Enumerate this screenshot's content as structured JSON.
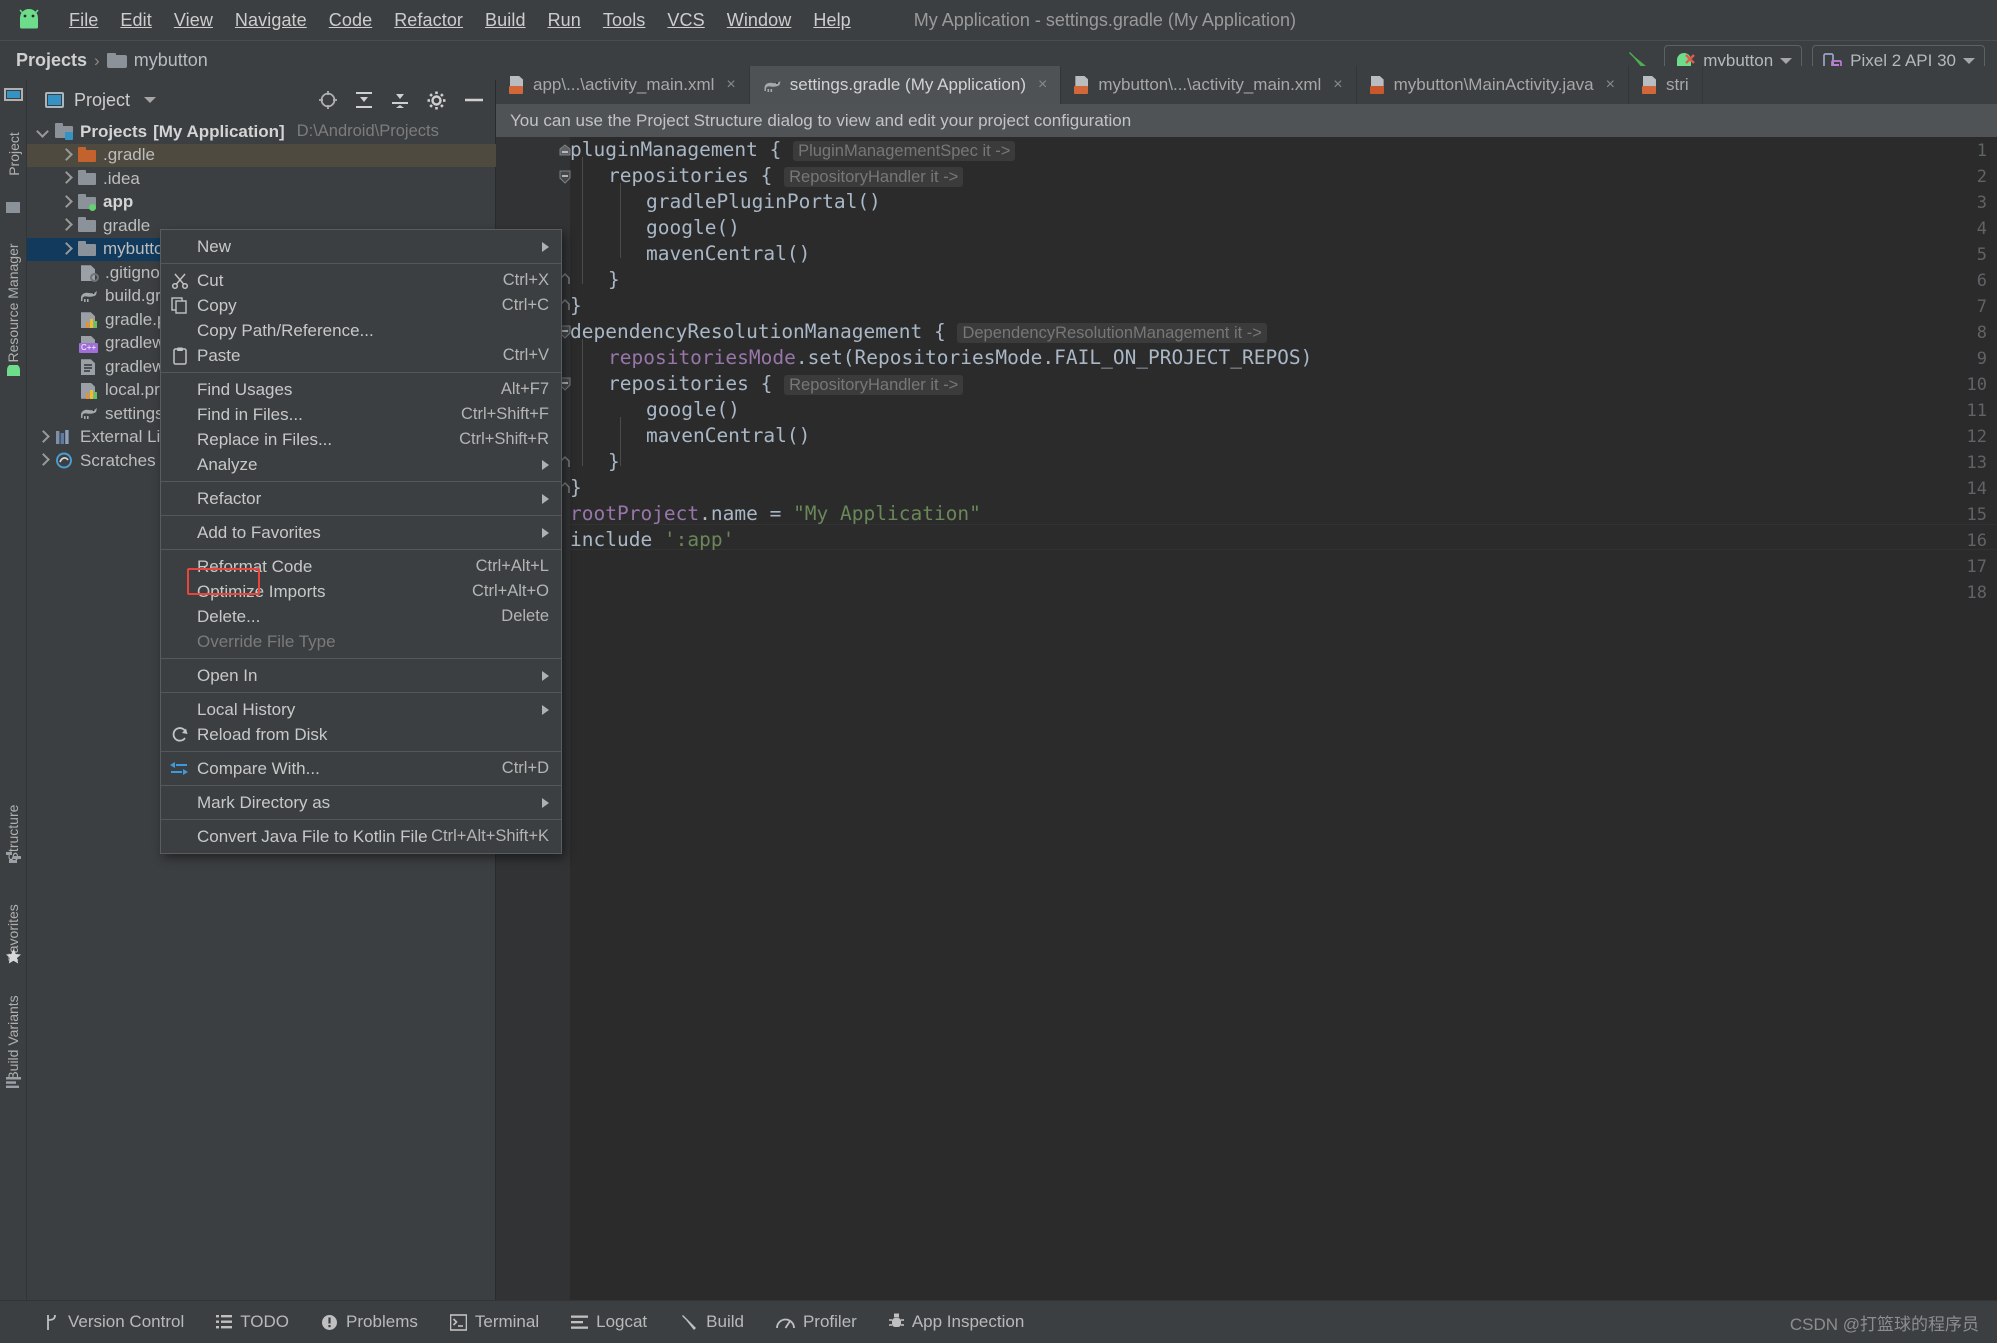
{
  "window": {
    "title": "My Application - settings.gradle (My Application)",
    "logo_icon": "android-logo-icon"
  },
  "menubar": {
    "items": [
      {
        "label": "File",
        "mnemonic": "F"
      },
      {
        "label": "Edit",
        "mnemonic": "E"
      },
      {
        "label": "View",
        "mnemonic": "V"
      },
      {
        "label": "Navigate",
        "mnemonic": "N"
      },
      {
        "label": "Code",
        "mnemonic": "C"
      },
      {
        "label": "Refactor",
        "mnemonic": "R"
      },
      {
        "label": "Build",
        "mnemonic": "B"
      },
      {
        "label": "Run",
        "mnemonic": "u"
      },
      {
        "label": "Tools",
        "mnemonic": "T"
      },
      {
        "label": "VCS",
        "mnemonic": "S"
      },
      {
        "label": "Window",
        "mnemonic": "W"
      },
      {
        "label": "Help",
        "mnemonic": "H"
      }
    ]
  },
  "navbar": {
    "root": "Projects",
    "separator": "›",
    "current": "mybutton",
    "hammer_icon": "hammer-icon",
    "run_config": "mybutton",
    "device": "Pixel 2 API 30"
  },
  "left_strip": {
    "top_labels": [
      "Project",
      "Resource Manager"
    ],
    "bottom_labels": [
      "Structure",
      "Favorites",
      "Build Variants"
    ]
  },
  "project_panel": {
    "title": "Project",
    "actions": [
      "locate-icon",
      "collapse-all-icon",
      "expand-icon",
      "settings-gear-icon",
      "minimize-icon"
    ],
    "tree": [
      {
        "label": "Projects",
        "suffix": "[My Application]",
        "path": "D:\\Android\\Projects",
        "icon": "project-folder-icon",
        "indent": 0,
        "arrow": "down",
        "bold": true,
        "state": "normal"
      },
      {
        "label": ".gradle",
        "icon": "folder-orange-icon",
        "indent": 1,
        "arrow": "right",
        "state": "selected-inactive"
      },
      {
        "label": ".idea",
        "icon": "folder-icon",
        "indent": 1,
        "arrow": "right",
        "state": "normal"
      },
      {
        "label": "app",
        "icon": "folder-module-icon",
        "indent": 1,
        "arrow": "right",
        "bold": true,
        "state": "normal"
      },
      {
        "label": "gradle",
        "icon": "folder-icon",
        "indent": 1,
        "arrow": "right",
        "state": "normal"
      },
      {
        "label": "mybutton",
        "icon": "folder-icon",
        "indent": 1,
        "arrow": "right",
        "state": "selected-active"
      },
      {
        "label": ".gitignore",
        "icon": "gitignore-file-icon",
        "indent": 2,
        "arrow": "none",
        "state": "normal"
      },
      {
        "label": "build.gra",
        "icon": "gradle-file-icon",
        "indent": 2,
        "arrow": "none",
        "state": "normal"
      },
      {
        "label": "gradle.pro",
        "icon": "properties-file-icon",
        "indent": 2,
        "arrow": "none",
        "state": "normal"
      },
      {
        "label": "gradlew",
        "icon": "cpp-file-icon",
        "indent": 2,
        "arrow": "none",
        "state": "normal"
      },
      {
        "label": "gradlew.b",
        "icon": "text-file-icon",
        "indent": 2,
        "arrow": "none",
        "state": "normal"
      },
      {
        "label": "local.prop",
        "icon": "properties-file-icon",
        "indent": 2,
        "arrow": "none",
        "state": "normal"
      },
      {
        "label": "settings.g",
        "icon": "gradle-file-icon",
        "indent": 2,
        "arrow": "none",
        "state": "normal"
      },
      {
        "label": "External Libr",
        "icon": "library-icon",
        "indent": 0,
        "arrow": "right",
        "state": "normal"
      },
      {
        "label": "Scratches an",
        "icon": "scratches-icon",
        "indent": 0,
        "arrow": "right",
        "state": "normal"
      }
    ]
  },
  "editor_tabs": [
    {
      "label": "app\\...\\activity_main.xml",
      "icon": "xml-file-icon",
      "active": false,
      "close": "×"
    },
    {
      "label": "settings.gradle (My Application)",
      "icon": "gradle-file-icon",
      "active": true,
      "close": "×"
    },
    {
      "label": "mybutton\\...\\activity_main.xml",
      "icon": "xml-file-icon",
      "active": false,
      "close": "×"
    },
    {
      "label": "mybutton\\MainActivity.java",
      "icon": "java-file-icon",
      "active": false,
      "close": "×"
    },
    {
      "label": "stri",
      "icon": "xml-file-icon",
      "active": false,
      "close": ""
    }
  ],
  "hint_bar": {
    "text": "You can use the Project Structure dialog to view and edit your project configuration"
  },
  "editor": {
    "filename": "settings.gradle",
    "lines": [
      {
        "no": "1",
        "indent": 0,
        "fold": "minus",
        "tokens": [
          {
            "t": "pluginManagement {",
            "c": "plain"
          },
          {
            "t": "PluginManagementSpec it ->",
            "c": "ghost"
          }
        ]
      },
      {
        "no": "2",
        "indent": 1,
        "fold": "minus",
        "tokens": [
          {
            "t": "repositories {",
            "c": "plain"
          },
          {
            "t": "RepositoryHandler it ->",
            "c": "ghost"
          }
        ]
      },
      {
        "no": "3",
        "indent": 2,
        "fold": "none",
        "tokens": [
          {
            "t": "gradlePluginPortal()",
            "c": "plain"
          }
        ]
      },
      {
        "no": "4",
        "indent": 2,
        "fold": "none",
        "tokens": [
          {
            "t": "google()",
            "c": "plain"
          }
        ]
      },
      {
        "no": "5",
        "indent": 2,
        "fold": "none",
        "tokens": [
          {
            "t": "mavenCentral()",
            "c": "plain"
          }
        ]
      },
      {
        "no": "6",
        "indent": 1,
        "fold": "end",
        "tokens": [
          {
            "t": "}",
            "c": "plain"
          }
        ]
      },
      {
        "no": "7",
        "indent": 0,
        "fold": "end",
        "tokens": [
          {
            "t": "}",
            "c": "plain"
          }
        ]
      },
      {
        "no": "8",
        "indent": 0,
        "fold": "none",
        "tokens": []
      },
      {
        "no": "9",
        "indent": 0,
        "fold": "minus",
        "tokens": [
          {
            "t": "dependencyResolutionManagement {",
            "c": "plain"
          },
          {
            "t": "DependencyResolutionManagement it ->",
            "c": "ghost"
          }
        ]
      },
      {
        "no": "10",
        "indent": 1,
        "fold": "none",
        "tokens": [
          {
            "t": "repositoriesMode",
            "c": "field"
          },
          {
            "t": ".set(RepositoriesMode.FAIL_ON_PROJECT_REPOS)",
            "c": "plain"
          }
        ]
      },
      {
        "no": "11",
        "indent": 1,
        "fold": "minus",
        "tokens": [
          {
            "t": "repositories {",
            "c": "plain"
          },
          {
            "t": "RepositoryHandler it ->",
            "c": "ghost"
          }
        ]
      },
      {
        "no": "12",
        "indent": 2,
        "fold": "none",
        "tokens": [
          {
            "t": "google()",
            "c": "plain"
          }
        ]
      },
      {
        "no": "13",
        "indent": 2,
        "fold": "none",
        "tokens": [
          {
            "t": "mavenCentral()",
            "c": "plain"
          }
        ]
      },
      {
        "no": "14",
        "indent": 1,
        "fold": "end",
        "tokens": [
          {
            "t": "}",
            "c": "plain"
          }
        ]
      },
      {
        "no": "15",
        "indent": 0,
        "fold": "end",
        "tokens": [
          {
            "t": "}",
            "c": "plain"
          }
        ]
      },
      {
        "no": "16",
        "indent": 0,
        "fold": "none",
        "tokens": []
      },
      {
        "no": "17",
        "indent": 0,
        "fold": "none",
        "tokens": [
          {
            "t": "rootProject",
            "c": "field"
          },
          {
            "t": ".name = ",
            "c": "plain"
          },
          {
            "t": "\"My Application\"",
            "c": "string"
          }
        ]
      },
      {
        "no": "18",
        "indent": 0,
        "fold": "none",
        "tokens": [
          {
            "t": "include ",
            "c": "plain"
          },
          {
            "t": "':app'",
            "c": "string"
          }
        ]
      }
    ]
  },
  "context_menu": {
    "items": [
      {
        "label": "New",
        "accel": "",
        "submenu": true,
        "icon": "",
        "sep_after": true
      },
      {
        "label": "Cut",
        "accel": "Ctrl+X",
        "icon": "scissors-icon",
        "mnemonic": "t"
      },
      {
        "label": "Copy",
        "accel": "Ctrl+C",
        "icon": "copy-icon",
        "mnemonic": "C"
      },
      {
        "label": "Copy Path/Reference...",
        "accel": "",
        "icon": ""
      },
      {
        "label": "Paste",
        "accel": "Ctrl+V",
        "icon": "paste-icon",
        "mnemonic": "P",
        "sep_after": true
      },
      {
        "label": "Find Usages",
        "accel": "Alt+F7",
        "icon": "",
        "mnemonic": "U"
      },
      {
        "label": "Find in Files...",
        "accel": "Ctrl+Shift+F",
        "icon": ""
      },
      {
        "label": "Replace in Files...",
        "accel": "Ctrl+Shift+R",
        "icon": "",
        "mnemonic": "a"
      },
      {
        "label": "Analyze",
        "accel": "",
        "submenu": true,
        "icon": "",
        "mnemonic": "z",
        "sep_after": true
      },
      {
        "label": "Refactor",
        "accel": "",
        "submenu": true,
        "icon": "",
        "mnemonic": "R",
        "sep_after": true
      },
      {
        "label": "Add to Favorites",
        "accel": "",
        "submenu": true,
        "icon": "",
        "mnemonic": "F",
        "sep_after": true
      },
      {
        "label": "Reformat Code",
        "accel": "Ctrl+Alt+L",
        "icon": "",
        "mnemonic": "R"
      },
      {
        "label": "Optimize Imports",
        "accel": "Ctrl+Alt+O",
        "icon": "",
        "mnemonic": "z"
      },
      {
        "label": "Delete...",
        "accel": "Delete",
        "icon": "",
        "mnemonic": "D",
        "highlighted": true
      },
      {
        "label": "Override File Type",
        "accel": "",
        "icon": "",
        "disabled": true,
        "sep_after": true
      },
      {
        "label": "Open In",
        "accel": "",
        "submenu": true,
        "icon": "",
        "sep_after": true
      },
      {
        "label": "Local History",
        "accel": "",
        "submenu": true,
        "icon": "",
        "mnemonic": "H"
      },
      {
        "label": "Reload from Disk",
        "accel": "",
        "icon": "reload-icon",
        "sep_after": true
      },
      {
        "label": "Compare With...",
        "accel": "Ctrl+D",
        "icon": "compare-icon",
        "sep_after": true
      },
      {
        "label": "Mark Directory as",
        "accel": "",
        "submenu": true,
        "icon": "",
        "sep_after": true
      },
      {
        "label": "Convert Java File to Kotlin File",
        "accel": "Ctrl+Alt+Shift+K",
        "icon": ""
      }
    ]
  },
  "bottom_bar": {
    "items": [
      {
        "label": "Version Control",
        "icon": "branch-icon"
      },
      {
        "label": "TODO",
        "icon": "list-icon"
      },
      {
        "label": "Problems",
        "icon": "warning-icon"
      },
      {
        "label": "Terminal",
        "icon": "terminal-icon"
      },
      {
        "label": "Logcat",
        "icon": "logcat-icon"
      },
      {
        "label": "Build",
        "icon": "hammer-icon"
      },
      {
        "label": "Profiler",
        "icon": "profiler-icon"
      },
      {
        "label": "App Inspection",
        "icon": "inspection-icon"
      }
    ],
    "watermark": "CSDN @打篮球的程序员"
  },
  "colors": {
    "chrome": "#3c3f41",
    "editor_bg": "#2b2b2b",
    "gutter_bg": "#313335",
    "accent_selected": "#113a5c",
    "accent_inactive": "#4e4a3f",
    "highlight_red": "#e8453c",
    "keyword": "#cc7832",
    "string": "#6a8759",
    "field": "#9876aa",
    "hint_bar": "#4f5355"
  }
}
